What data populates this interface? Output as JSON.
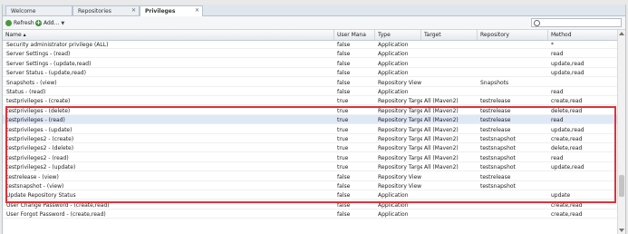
{
  "tabs": [
    {
      "label": "Welcome",
      "active": false
    },
    {
      "label": "Repositories",
      "active": false
    },
    {
      "label": "Privileges",
      "active": true
    }
  ],
  "toolbar": {
    "refresh_label": "Refresh",
    "add_label": "Add...",
    "search_placeholder": ""
  },
  "columns": [
    "Name",
    "User Mana",
    "Type",
    "Target",
    "Repository",
    "Method"
  ],
  "rows": [
    [
      "Security administrator privilege (ALL)",
      "false",
      "Application",
      "",
      "",
      "*"
    ],
    [
      "Server Settings - (read)",
      "false",
      "Application",
      "",
      "",
      "read"
    ],
    [
      "Server Settings - (update,read)",
      "false",
      "Application",
      "",
      "",
      "update,read"
    ],
    [
      "Server Status - (update,read)",
      "false",
      "Application",
      "",
      "",
      "update,read"
    ],
    [
      "Snapshots - (view)",
      "false",
      "Repository View",
      "",
      "Snapshots",
      ""
    ],
    [
      "Status - (read)",
      "false",
      "Application",
      "",
      "",
      "read"
    ],
    [
      "testprivileges - (create)",
      "true",
      "Repository Target",
      "All (Maven2)",
      "testrelease",
      "create,read"
    ],
    [
      "testprivileges - (delete)",
      "true",
      "Repository Target",
      "All (Maven2)",
      "testrelease",
      "delete,read"
    ],
    [
      "testprivileges - (read)",
      "true",
      "Repository Target",
      "All (Maven2)",
      "testrelease",
      "read"
    ],
    [
      "testprivileges - (update)",
      "true",
      "Repository Target",
      "All (Maven2)",
      "testrelease",
      "update,read"
    ],
    [
      "testprivileges2 - (create)",
      "true",
      "Repository Target",
      "All (Maven2)",
      "testsnapshot",
      "create,read"
    ],
    [
      "testprivileges2 - (delete)",
      "true",
      "Repository Target",
      "All (Maven2)",
      "testsnapshot",
      "delete,read"
    ],
    [
      "testprivileges2 - (read)",
      "true",
      "Repository Target",
      "All (Maven2)",
      "testsnapshot",
      "read"
    ],
    [
      "testprivileges2 - (update)",
      "true",
      "Repository Target",
      "All (Maven2)",
      "testsnapshot",
      "update,read"
    ],
    [
      "testrelease - (view)",
      "false",
      "Repository View",
      "",
      "testrelease",
      ""
    ],
    [
      "testsnapshot - (view)",
      "false",
      "Repository View",
      "",
      "testsnapshot",
      ""
    ],
    [
      "Update Repository Status",
      "false",
      "Application",
      "",
      "",
      "update"
    ],
    [
      "User Change Password - (create,read)",
      "false",
      "Application",
      "",
      "",
      "create,read"
    ],
    [
      "User Forgot Password - (create,read)",
      "false",
      "Application",
      "",
      "",
      "create,read"
    ]
  ],
  "selected_row": 8,
  "highlight_color": "#e0313a"
}
